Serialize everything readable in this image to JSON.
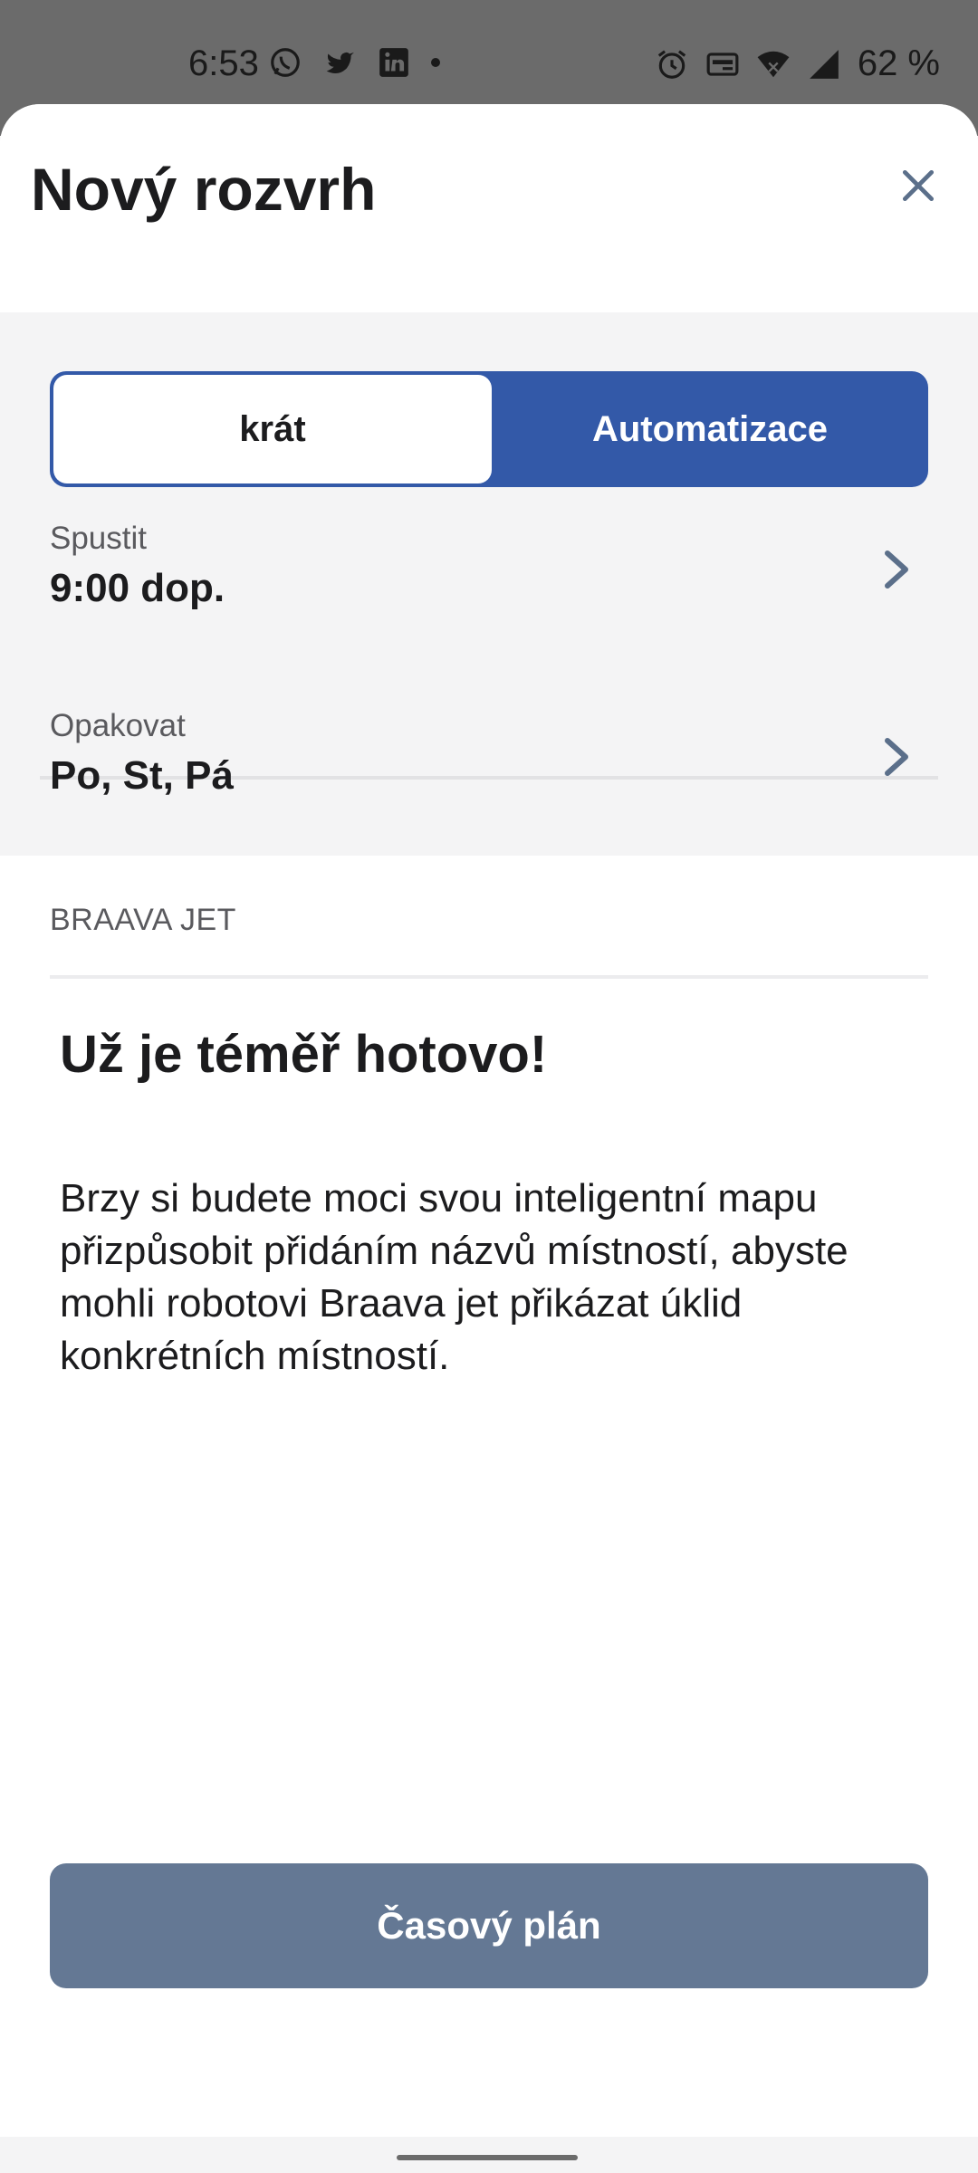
{
  "status_bar": {
    "time": "6:53",
    "battery": "62 %",
    "left_icons": [
      "whatsapp-icon",
      "twitter-icon",
      "linkedin-icon",
      "notification-dot-icon"
    ],
    "right_icons": [
      "alarm-icon",
      "auto-hz-icon",
      "wifi-icon",
      "cell-signal-icon"
    ]
  },
  "sheet": {
    "title": "Nový rozvrh"
  },
  "segmented": {
    "left_label": "krát",
    "right_label": "Automatizace",
    "selected": "Automatizace",
    "accent_color": "#3359a8"
  },
  "rows": [
    {
      "label": "Spustit",
      "value": "9:00 dop."
    },
    {
      "label": "Opakovat",
      "value": "Po, St, Pá"
    }
  ],
  "section": {
    "label": "BRAAVA JET",
    "heading": "Už je téměř hotovo!",
    "body": "Brzy si budete moci svou inteligentní mapu přizpůsobit přidáním názvů místností, abyste mohli robotovi Braava jet přikázat úklid konkrétních místností."
  },
  "primary_button": {
    "label": "Časový plán",
    "color": "#647894"
  }
}
